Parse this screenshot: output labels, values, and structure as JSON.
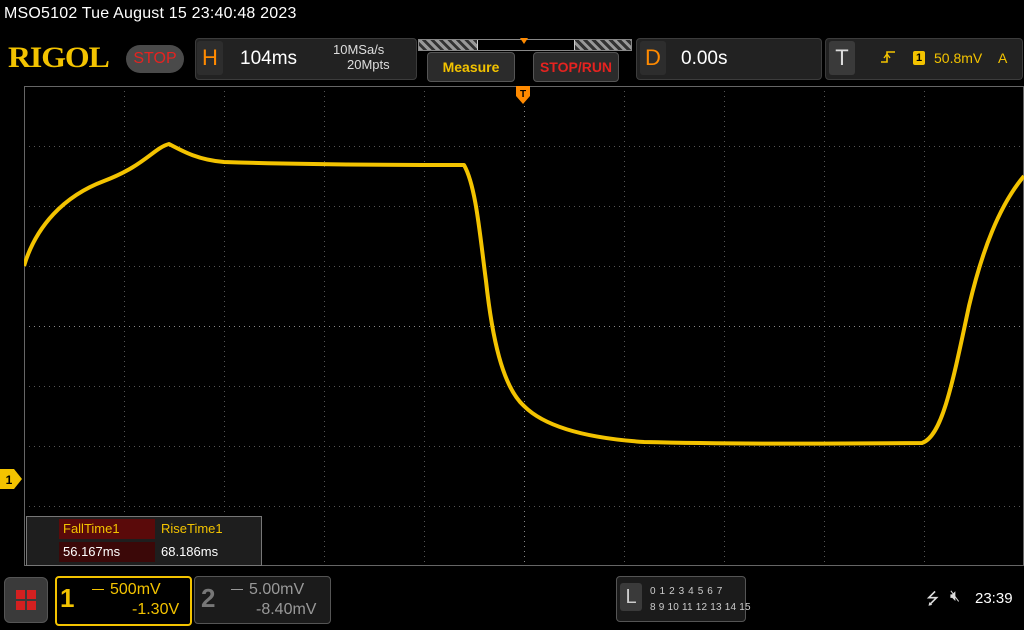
{
  "header": {
    "title_line": "MSO5102  Tue August 15 23:40:48 2023",
    "logo": "RIGOL",
    "run_state": "STOP"
  },
  "horizontal": {
    "badge": "H",
    "timebase": "104ms",
    "sample_rate": "10MSa/s",
    "memory_depth": "20Mpts"
  },
  "buttons": {
    "measure": "Measure",
    "stop_run": "STOP/RUN"
  },
  "delay": {
    "badge": "D",
    "value": "0.00s"
  },
  "trigger": {
    "badge": "T",
    "edge_icon": "rising-edge-icon",
    "source": "1",
    "level": "50.8mV",
    "mode": "A"
  },
  "waveform": {
    "channel": "1",
    "color": "#f3c300",
    "marker_label": "1"
  },
  "measurements": {
    "fall_label": "FallTime1",
    "rise_label": "RiseTime1",
    "fall_value": "56.167ms",
    "rise_value": "68.186ms"
  },
  "channels": {
    "ch1": {
      "number": "1",
      "scale": "500mV",
      "offset": "-1.30V"
    },
    "ch2": {
      "number": "2",
      "scale": "5.00mV",
      "offset": "-8.40mV"
    }
  },
  "logic": {
    "badge": "L",
    "row1": "0 1 2 3  4 5 6 7",
    "row2": "8 9 10 11 12 13 14 15"
  },
  "status": {
    "usb_icon": "usb-icon",
    "sound_icon": "muted-speaker-icon",
    "time": "23:39"
  },
  "colors": {
    "ch1": "#f3c300",
    "accent_orange": "#ff8a00",
    "stop_red": "#e52320"
  }
}
